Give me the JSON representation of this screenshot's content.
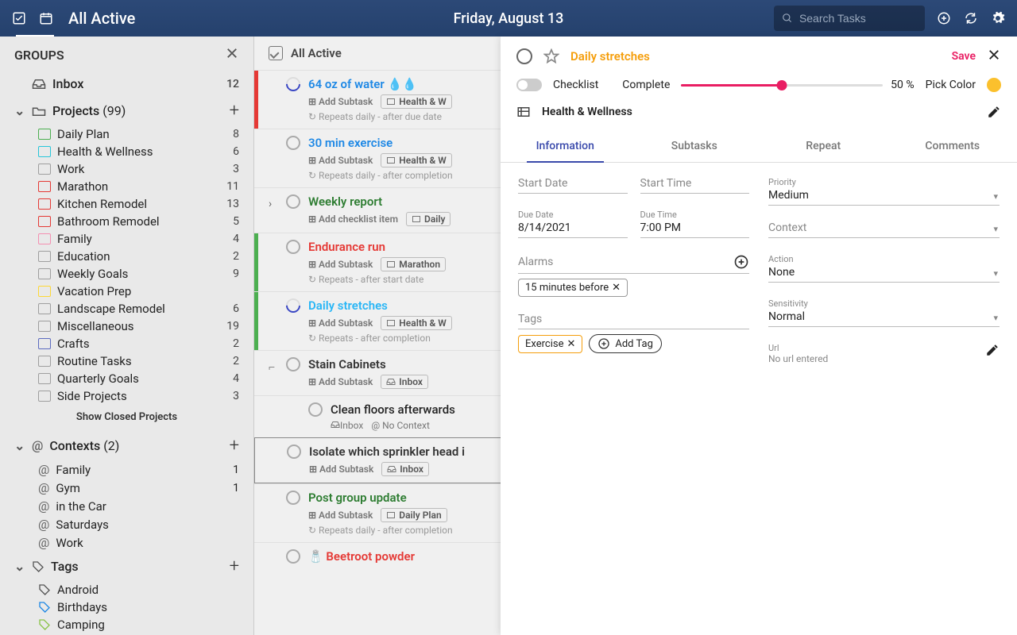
{
  "header": {
    "view_title": "All Active",
    "date": "Friday, August 13",
    "search_placeholder": "Search Tasks"
  },
  "sidebar": {
    "title": "GROUPS",
    "inbox": {
      "label": "Inbox",
      "count": 12
    },
    "projects": {
      "label": "Projects",
      "count_suffix": "(99)",
      "items": [
        {
          "label": "Daily Plan",
          "count": 8,
          "color": "#4caf50"
        },
        {
          "label": "Health & Wellness",
          "count": 6,
          "color": "#26c6da"
        },
        {
          "label": "Work",
          "count": 3,
          "color": "#9e9e9e"
        },
        {
          "label": "Marathon",
          "count": 11,
          "color": "#e53935"
        },
        {
          "label": "Kitchen Remodel",
          "count": 13,
          "color": "#e53935"
        },
        {
          "label": "Bathroom Remodel",
          "count": 5,
          "color": "#e53935"
        },
        {
          "label": "Family",
          "count": 4,
          "color": "#f48fb1"
        },
        {
          "label": "Education",
          "count": 2,
          "color": "#9e9e9e"
        },
        {
          "label": "Weekly Goals",
          "count": 9,
          "color": "#9e9e9e"
        },
        {
          "label": "Vacation Prep",
          "count": "",
          "color": "#fdd835"
        },
        {
          "label": "Landscape Remodel",
          "count": 6,
          "color": "#9e9e9e"
        },
        {
          "label": "Miscellaneous",
          "count": 19,
          "color": "#9e9e9e"
        },
        {
          "label": "Crafts",
          "count": 2,
          "color": "#5c6bc0"
        },
        {
          "label": "Routine Tasks",
          "count": 2,
          "color": "#9e9e9e"
        },
        {
          "label": "Quarterly Goals",
          "count": 4,
          "color": "#9e9e9e"
        },
        {
          "label": "Side Projects",
          "count": 3,
          "color": "#9e9e9e"
        }
      ],
      "show_closed": "Show Closed Projects"
    },
    "contexts": {
      "label": "Contexts",
      "count_suffix": "(2)",
      "items": [
        {
          "label": "Family",
          "count": 1
        },
        {
          "label": "Gym",
          "count": 1
        },
        {
          "label": "in the Car",
          "count": ""
        },
        {
          "label": "Saturdays",
          "count": ""
        },
        {
          "label": "Work",
          "count": ""
        }
      ]
    },
    "tags": {
      "label": "Tags",
      "items": [
        {
          "label": "Android",
          "color": "#555"
        },
        {
          "label": "Birthdays",
          "color": "#1e88e5"
        },
        {
          "label": "Camping",
          "color": "#8bc34a"
        }
      ]
    }
  },
  "tasklist": {
    "header": "All Active",
    "tasks": [
      {
        "title": "64 oz of water 💧💧",
        "color": "#1e88e5",
        "bar": "#e53935",
        "progress": true,
        "add": "Add Subtask",
        "pill": "Health & W",
        "repeat": "Repeats daily - after due date"
      },
      {
        "title": "30 min exercise",
        "color": "#1e88e5",
        "bar": "",
        "progress": false,
        "add": "Add Subtask",
        "pill": "Health & W",
        "repeat": "Repeats daily - after completion"
      },
      {
        "title": "Weekly report",
        "color": "#2e7d32",
        "bar": "",
        "progress": false,
        "expand": true,
        "add": "Add checklist item",
        "pill": "Daily"
      },
      {
        "title": "Endurance run",
        "color": "#e53935",
        "bar": "#4caf50",
        "progress": false,
        "add": "Add Subtask",
        "pill": "Marathon",
        "repeat": "Repeats - after start date"
      },
      {
        "title": "Daily stretches",
        "color": "#29b6f6",
        "bar": "#4caf50",
        "progress": true,
        "add": "Add Subtask",
        "pill": "Health & W",
        "repeat": "Repeats - after completion"
      },
      {
        "title": "Stain Cabinets",
        "color": "#333",
        "bar": "",
        "progress": false,
        "add": "Add Subtask",
        "pill_inbox": "Inbox",
        "indent_icon": true
      },
      {
        "subtask": true,
        "title": "Clean floors afterwards",
        "pill_inbox": "Inbox",
        "pill_ctx": "No Context"
      },
      {
        "title": "Isolate which sprinkler head i",
        "color": "#333",
        "bar": "",
        "progress": false,
        "selected": true,
        "add": "Add Subtask",
        "pill_inbox": "Inbox"
      },
      {
        "title": "Post group update",
        "color": "#2e7d32",
        "bar": "",
        "progress": false,
        "add": "Add Subtask",
        "pill": "Daily Plan",
        "repeat": "Repeats daily - after completion"
      },
      {
        "title": "Beetroot powder",
        "color": "#e53935",
        "bar": "",
        "progress": false,
        "emoji": "🧂"
      }
    ]
  },
  "detail": {
    "title": "Daily stretches",
    "save": "Save",
    "checklist_label": "Checklist",
    "complete_label": "Complete",
    "complete_pct": "50 %",
    "pick_color": "Pick Color",
    "project": "Health & Wellness",
    "tabs": [
      "Information",
      "Subtasks",
      "Repeat",
      "Comments"
    ],
    "fields": {
      "start_date": {
        "label": "Start Date",
        "value": ""
      },
      "start_time": {
        "label": "Start Time",
        "value": ""
      },
      "priority": {
        "label": "Priority",
        "value": "Medium"
      },
      "due_date": {
        "label": "Due Date",
        "value": "8/14/2021"
      },
      "due_time": {
        "label": "Due Time",
        "value": "7:00 PM"
      },
      "context": {
        "label": "Context",
        "value": ""
      },
      "alarms": {
        "label": "Alarms"
      },
      "alarm_chip": "15 minutes before",
      "action": {
        "label": "Action",
        "value": "None"
      },
      "tags": {
        "label": "Tags"
      },
      "tag_chip": "Exercise",
      "add_tag": "Add Tag",
      "sensitivity": {
        "label": "Sensitivity",
        "value": "Normal"
      },
      "url": {
        "label": "Url",
        "value": "No url entered"
      }
    }
  }
}
